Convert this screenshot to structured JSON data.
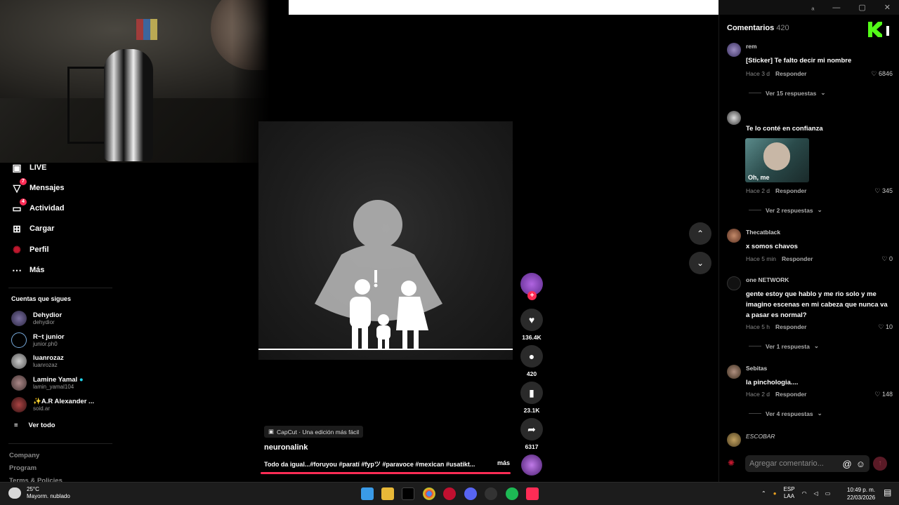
{
  "sidebar": {
    "nav": [
      {
        "label": "LIVE",
        "icon": "live-icon",
        "badge": ""
      },
      {
        "label": "Mensajes",
        "icon": "messages-icon",
        "badge": "7"
      },
      {
        "label": "Actividad",
        "icon": "activity-icon",
        "badge": "4"
      },
      {
        "label": "Cargar",
        "icon": "upload-icon",
        "badge": ""
      },
      {
        "label": "Perfil",
        "icon": "profile-icon",
        "badge": ""
      },
      {
        "label": "Más",
        "icon": "more-icon",
        "badge": ""
      }
    ],
    "following_title": "Cuentas que sigues",
    "following": [
      {
        "name": "Dehydior",
        "handle": "dehydior"
      },
      {
        "name": "R~t junior",
        "handle": "junior.ph0"
      },
      {
        "name": "luanrozaz",
        "handle": "luanrozaz"
      },
      {
        "name": "Lamine Yamal",
        "handle": "lamin_yamal104"
      },
      {
        "name": "✨A.R Alexander ...",
        "handle": "soid.ar"
      }
    ],
    "see_all": "Ver todo",
    "footer": [
      "Company",
      "Program",
      "Terms & Policies"
    ]
  },
  "video": {
    "tag": "CapCut · Una edición más fácil",
    "author": "neuronalink",
    "description": "Todo da igual...#foruyou #paratí #fypツ #paravoce #mexican #usatikt...",
    "more": "más",
    "progress": 1.0
  },
  "actions": {
    "likes": "136.4K",
    "comments": "420",
    "saves": "23.1K",
    "shares": "6317"
  },
  "comments_panel": {
    "title": "Comentarios",
    "count": "420",
    "items": [
      {
        "user": "rem",
        "text": "[Sticker] Te falto decir mi nombre",
        "time": "Hace 3 d",
        "reply": "Responder",
        "likes": "6846",
        "replies": "Ver 15 respuestas"
      },
      {
        "user": "",
        "text": "Te lo conté en confianza",
        "image_caption": "Oh, me",
        "time": "Hace 2 d",
        "reply": "Responder",
        "likes": "345",
        "replies": "Ver 2 respuestas"
      },
      {
        "user": "Thecatblack",
        "text": "x somos chavos",
        "time": "Hace 5 min",
        "reply": "Responder",
        "likes": "0",
        "replies": ""
      },
      {
        "user": "one NETWORK",
        "text": "gente estoy que hablo y me rio solo y me imagino escenas en mi cabeza que nunca va a pasar es normal?",
        "time": "Hace 5 h",
        "reply": "Responder",
        "likes": "10",
        "replies": "Ver 1 respuesta"
      },
      {
        "user": "Sebitas",
        "text": "la pinchologia....",
        "time": "Hace 2 d",
        "reply": "Responder",
        "likes": "148",
        "replies": "Ver 4 respuestas"
      },
      {
        "user": "ESCOBAR",
        "text": "",
        "time": "",
        "reply": "",
        "likes": "",
        "replies": ""
      }
    ],
    "input_placeholder": "Agregar comentario..."
  },
  "taskbar": {
    "temp": "25°C",
    "weather": "Mayorm. nublado",
    "lang_top": "ESP",
    "lang_bottom": "LAA",
    "time": "10:49 p. m.",
    "date": "22/03/2026"
  },
  "colors": {
    "accent": "#fe2c55",
    "bg": "#000000"
  }
}
